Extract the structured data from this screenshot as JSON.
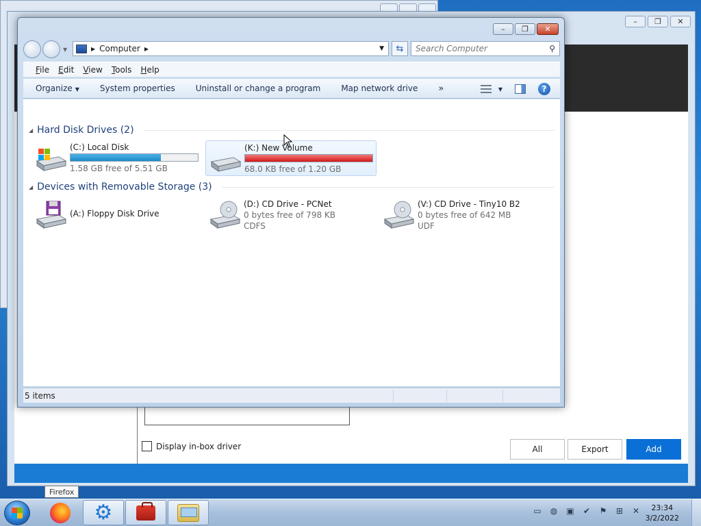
{
  "explorer": {
    "address": {
      "location": "Computer"
    },
    "search": {
      "placeholder": "Search Computer"
    },
    "menu": [
      "File",
      "Edit",
      "View",
      "Tools",
      "Help"
    ],
    "toolbar": {
      "organize": "Organize",
      "system_properties": "System properties",
      "uninstall": "Uninstall or change a program",
      "map_drive": "Map network drive",
      "more": "»"
    },
    "groups": [
      {
        "title": "Hard Disk Drives (2)",
        "drives": [
          {
            "name": "(C:) Local Disk",
            "free_text": "1.58 GB free of 5.51 GB",
            "used_fraction": 0.71,
            "bar_color": "#1e8bc8"
          },
          {
            "name": "(K:) New Volume",
            "free_text": "68.0 KB free of 1.20 GB",
            "used_fraction": 1.0,
            "bar_color": "#d41818"
          }
        ]
      },
      {
        "title": "Devices with Removable Storage (3)",
        "drives": [
          {
            "name": "(A:) Floppy Disk Drive"
          },
          {
            "name": "(D:) CD Drive - PCNet",
            "line2": "0 bytes free of 798 KB",
            "line3": "CDFS"
          },
          {
            "name": "(V:) CD Drive - Tiny10 B2",
            "line2": "0 bytes free of 642 MB",
            "line3": "UDF"
          }
        ]
      }
    ],
    "status": {
      "count": "5 items"
    }
  },
  "background_app": {
    "checkbox_label": "Display in-box driver",
    "buttons": {
      "all": "All",
      "export": "Export",
      "add": "Add"
    }
  },
  "taskbar": {
    "tooltip": "Firefox",
    "clock": {
      "time": "23:34",
      "date": "3/2/2022"
    }
  }
}
